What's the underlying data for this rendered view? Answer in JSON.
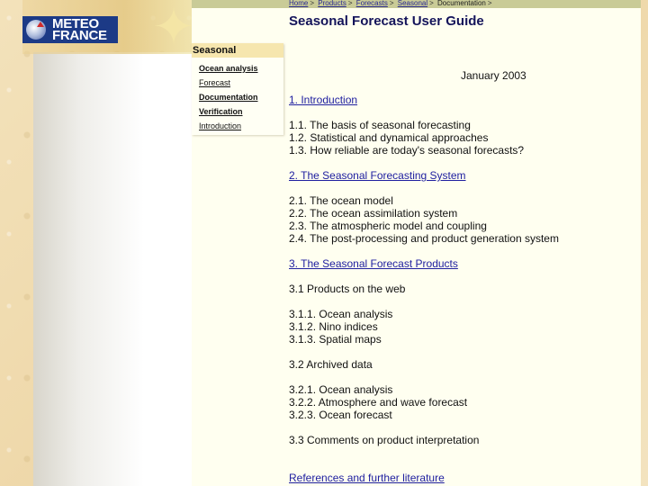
{
  "logo": {
    "line1": "METEO",
    "line2": "FRANCE"
  },
  "breadcrumb": [
    {
      "label": "Home",
      "link": true
    },
    {
      "label": "Products",
      "link": true
    },
    {
      "label": "Forecasts",
      "link": true
    },
    {
      "label": "Seasonal",
      "link": true
    },
    {
      "label": "Documentation",
      "link": false
    }
  ],
  "breadcrumb_separator": ">",
  "page_title": "Seasonal Forecast User Guide",
  "sidebar": {
    "heading": "Seasonal",
    "items": [
      {
        "label": "Ocean analysis"
      },
      {
        "label": "Forecast"
      },
      {
        "label": "Documentation"
      },
      {
        "label": "Verification"
      },
      {
        "label": "Introduction"
      }
    ]
  },
  "date": "January 2003",
  "toc": {
    "s1": {
      "title": "1. Introduction",
      "items": [
        "1.1. The basis of seasonal forecasting",
        "1.2. Statistical and dynamical approaches",
        "1.3. How reliable are today's seasonal forecasts?"
      ]
    },
    "s2": {
      "title": "2. The Seasonal Forecasting System",
      "items": [
        "2.1. The ocean model",
        "2.2. The ocean assimilation system",
        "2.3. The atmospheric model and coupling",
        "2.4. The post-processing and product generation system"
      ]
    },
    "s3": {
      "title": "3. The Seasonal Forecast Products",
      "sub1": {
        "title": "3.1 Products on the web",
        "items": [
          "3.1.1. Ocean analysis",
          "3.1.2. Nino indices",
          "3.1.3. Spatial maps"
        ]
      },
      "sub2": {
        "title": "3.2 Archived data",
        "items": [
          "3.2.1. Ocean analysis",
          "3.2.2. Atmosphere and wave forecast",
          "3.2.3. Ocean forecast"
        ]
      },
      "sub3": {
        "title": "3.3 Comments on product interpretation"
      }
    },
    "references": "References and further literature"
  },
  "colors": {
    "crumb_bar": "#c9cb97",
    "content_bg": "#fffff0",
    "title": "#14145a",
    "link": "#2020a0",
    "sidebar_heading_bg": "#f6e6ae",
    "logo_bg": "#1c3a86"
  }
}
